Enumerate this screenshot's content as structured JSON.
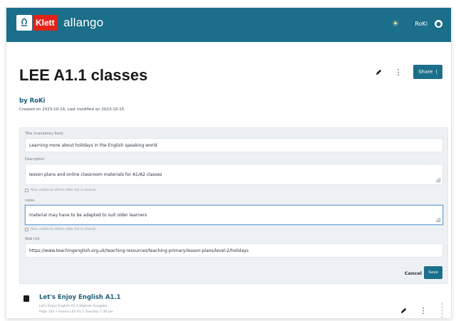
{
  "header": {
    "brand_klett": "Klett",
    "brand_allango": "allango",
    "user": "RoKi"
  },
  "page": {
    "title": "LEE A1.1 classes",
    "byline": "by RoKi",
    "created": "Created on 2023-10-14, Last modified on 2023-10-15",
    "share_label": "Share"
  },
  "form": {
    "title_label": "Title (mandatory field)",
    "title_value": "Learning more about holidays in the English speaking world",
    "description_label": "Description",
    "description_value": "lesson plans and online classroom materials for A1/A2 classes",
    "description_hint": "Also visible to others after list is shared.",
    "notes_label": "notes",
    "notes_value": "material may have to be adapted to suit older learners",
    "notes_hint": "Also visible to others after list is shared.",
    "weblink_label": "Web link",
    "weblink_value": "https://www.teachingenglish.org.uk/teaching-resources/teaching-primary/lesson-plans/level-2/holidays",
    "cancel_label": "Cancel",
    "save_label": "Save"
  },
  "resource": {
    "title": "Let's Enjoy English A1.1",
    "line1": "Let's Enjoy English A1.1 Digitale Ausgabe",
    "line2": "Page 143 • lesson LEE A1.1 Tuesday 7:30 pm"
  },
  "colors": {
    "header_bg": "#1b6f8a",
    "klett_red": "#e2231a",
    "link_blue": "#1b5e7a"
  },
  "icons": [
    "klett-logo-icon",
    "sun-icon",
    "user-icon",
    "pencil-icon",
    "more-vertical-icon",
    "share-icon",
    "document-icon"
  ]
}
